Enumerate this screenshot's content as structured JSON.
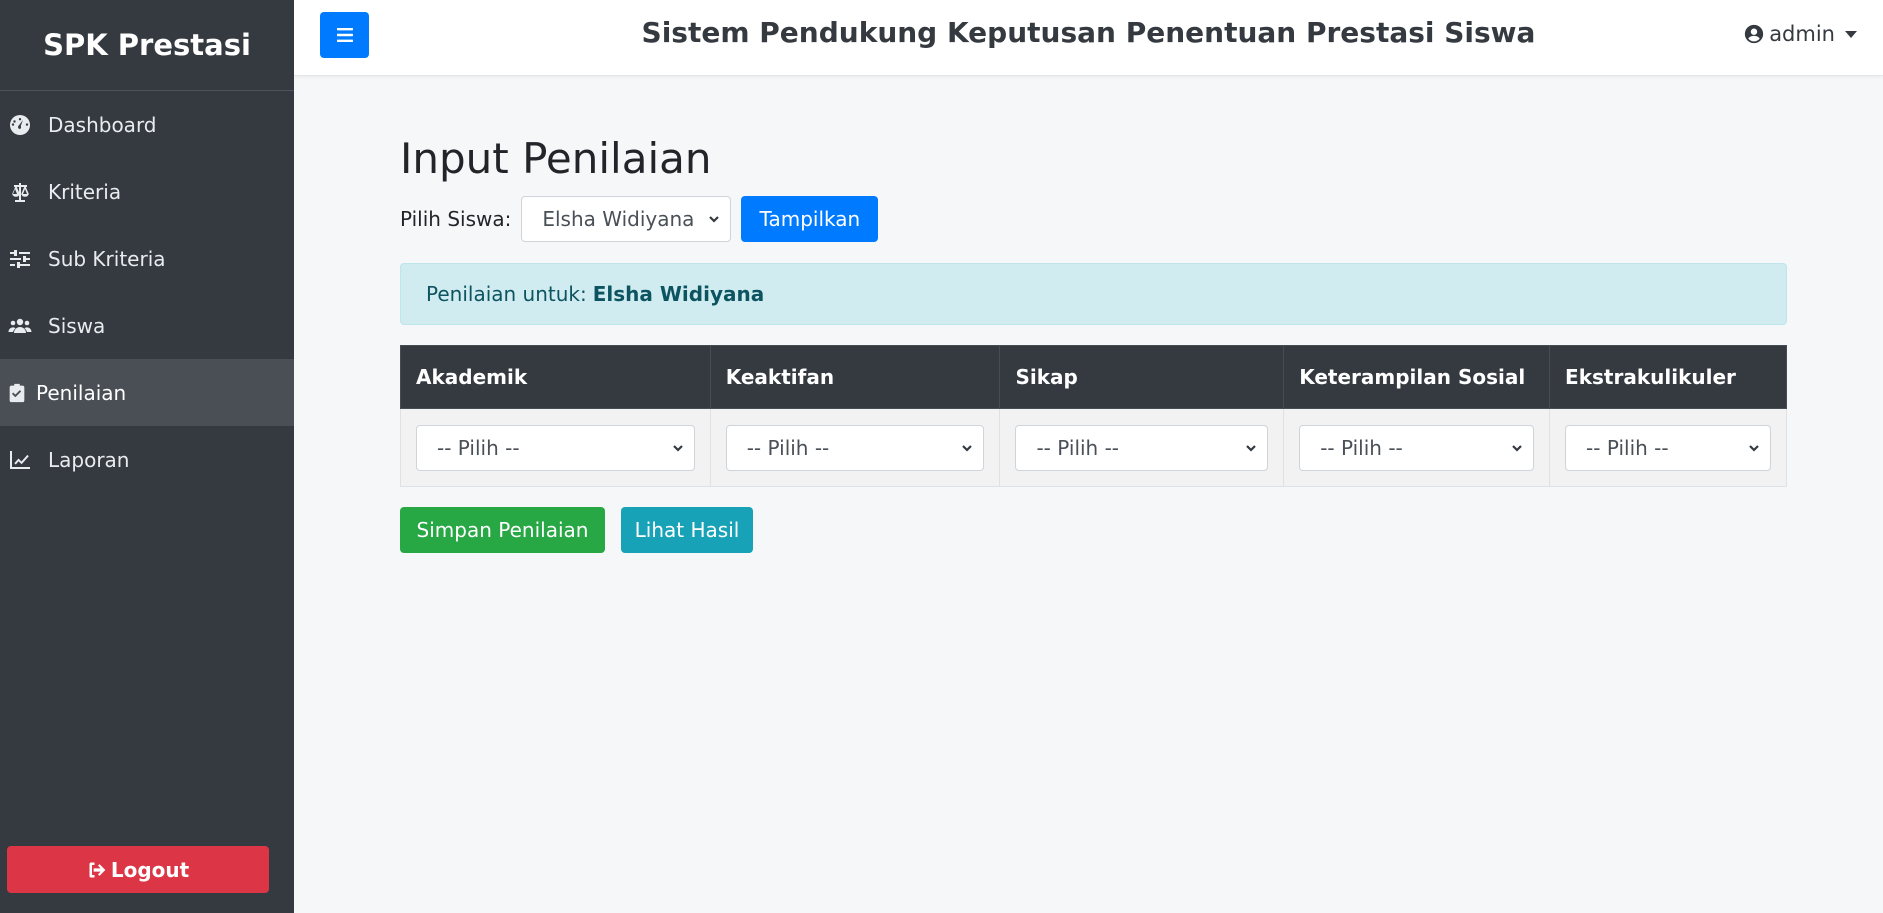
{
  "app": {
    "brand": "SPK Prestasi",
    "title": "Sistem Pendukung Keputusan Penentuan Prestasi Siswa"
  },
  "sidebar": {
    "items": [
      {
        "label": "Dashboard",
        "icon": "dashboard-icon",
        "active": false
      },
      {
        "label": "Kriteria",
        "icon": "balance-scale-icon",
        "active": false
      },
      {
        "label": "Sub Kriteria",
        "icon": "sliders-icon",
        "active": false
      },
      {
        "label": "Siswa",
        "icon": "users-icon",
        "active": false
      },
      {
        "label": "Penilaian",
        "icon": "clipboard-check-icon",
        "active": true
      },
      {
        "label": "Laporan",
        "icon": "line-chart-icon",
        "active": false
      }
    ],
    "logout_label": "Logout"
  },
  "topbar": {
    "user": "admin"
  },
  "page": {
    "title": "Input Penilaian",
    "filter_label": "Pilih Siswa:",
    "selected_student": "Elsha Widiyana",
    "show_button": "Tampilkan",
    "alert_prefix": "Penilaian untuk:",
    "alert_name": "Elsha Widiyana"
  },
  "table": {
    "headers": [
      "Akademik",
      "Keaktifan",
      "Sikap",
      "Keterampilan Sosial",
      "Ekstrakulikuler"
    ],
    "row": [
      "-- Pilih --",
      "-- Pilih --",
      "-- Pilih --",
      "-- Pilih --",
      "-- Pilih --"
    ]
  },
  "actions": {
    "save_label": "Simpan Penilaian",
    "result_label": "Lihat Hasil"
  },
  "colors": {
    "sidebar": "#343a40",
    "primary": "#007bff",
    "success": "#28a745",
    "info": "#17a2b8",
    "danger": "#dc3545"
  }
}
